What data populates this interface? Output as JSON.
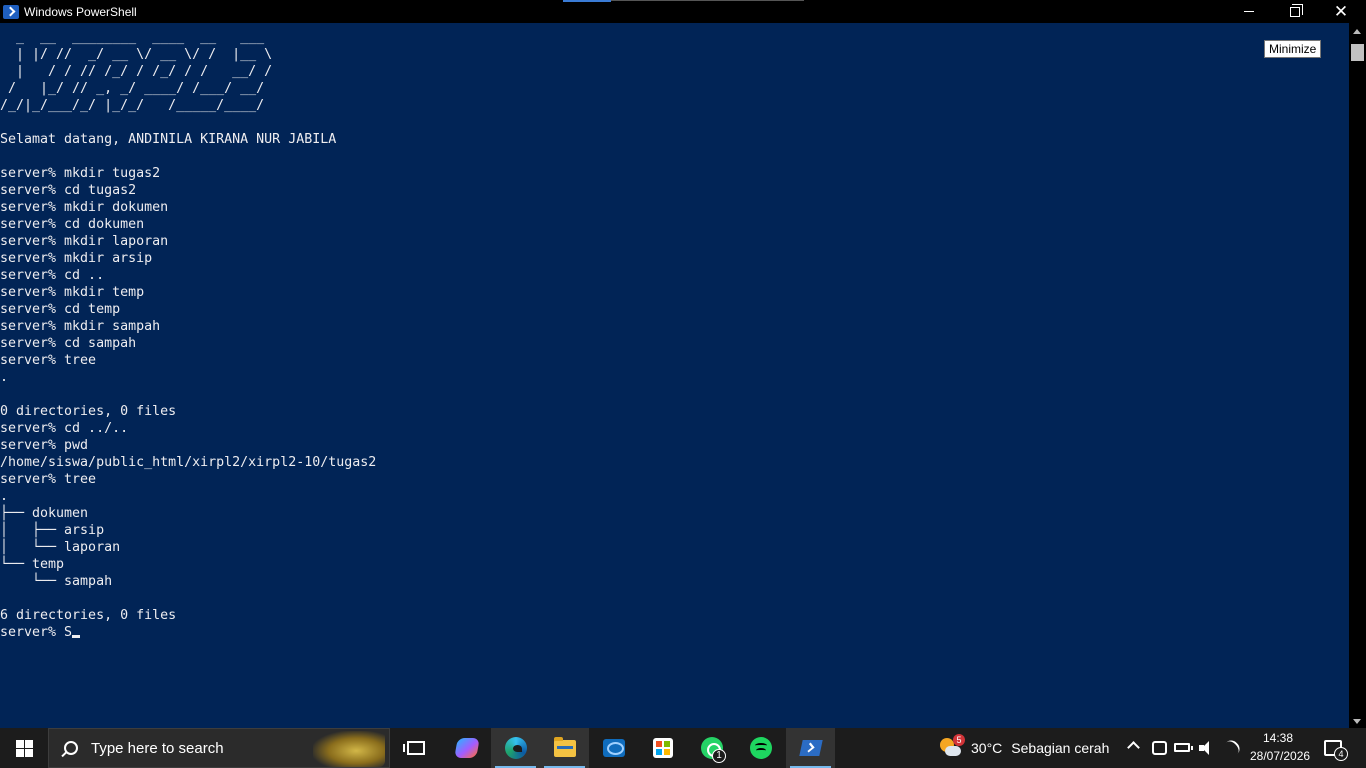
{
  "window": {
    "title": "Windows PowerShell",
    "minimize_tooltip": "Minimize",
    "icons": [
      "powershell-icon",
      "minimize-icon",
      "maximize-icon",
      "close-icon"
    ]
  },
  "terminal": {
    "lines": [
      "  _  __  ________  ____  __   ___ ",
      "  | |/ //  _/ __ \\/ __ \\/ /  |__ \\",
      "  |   / / // /_/ / /_/ / /   __/ /",
      " /   |_/ // _, _/ ____/ /___/ __/ ",
      "/_/|_/___/_/ |_/_/   /_____/____/ ",
      "",
      "Selamat datang, ANDINILA KIRANA NUR JABILA",
      "",
      "server% mkdir tugas2",
      "server% cd tugas2",
      "server% mkdir dokumen",
      "server% cd dokumen",
      "server% mkdir laporan",
      "server% mkdir arsip",
      "server% cd ..",
      "server% mkdir temp",
      "server% cd temp",
      "server% mkdir sampah",
      "server% cd sampah",
      "server% tree",
      ".",
      "",
      "0 directories, 0 files",
      "server% cd ../..",
      "server% pwd",
      "/home/siswa/public_html/xirpl2/xirpl2-10/tugas2",
      "server% tree",
      ".",
      "├── dokumen",
      "│   ├── arsip",
      "│   └── laporan",
      "└── temp",
      "    └── sampah",
      "",
      "6 directories, 0 files"
    ],
    "current_input": "server% S"
  },
  "taskbar": {
    "search_placeholder": "Type here to search",
    "pinned": [
      {
        "name": "task-view",
        "icon": "task-view-icon"
      },
      {
        "name": "copilot",
        "icon": "copilot-icon"
      },
      {
        "name": "edge",
        "icon": "edge-icon"
      },
      {
        "name": "file-explorer",
        "icon": "folder-icon"
      },
      {
        "name": "outlook",
        "icon": "outlook-icon"
      },
      {
        "name": "microsoft-store",
        "icon": "store-icon"
      },
      {
        "name": "whatsapp",
        "icon": "whatsapp-icon",
        "badge": "1"
      },
      {
        "name": "spotify",
        "icon": "spotify-icon"
      },
      {
        "name": "powershell",
        "icon": "powershell-icon",
        "active": true
      }
    ],
    "whatsapp_badge": "1",
    "weather": {
      "badge": "5",
      "temp": "30°C",
      "desc": "Sebagian cerah"
    },
    "clock": {
      "time": "14:38",
      "date": "28/07/2026"
    },
    "notification_count": "4"
  },
  "colors": {
    "terminal_bg": "#012456",
    "terminal_fg": "#eeedf0",
    "titlebar_bg": "#000000",
    "taskbar_bg": "#1c1c1c",
    "active_indicator": "#76b9ed"
  }
}
